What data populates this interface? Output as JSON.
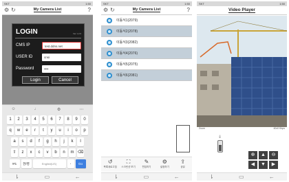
{
  "login_screen": {
    "status_time": "1:50",
    "status_left": "SKT",
    "header_title": "My Camera List",
    "dialog_title": "LOGIN",
    "version": "Ver 1.2.6",
    "cms_ip_label": "CMS IP",
    "cms_ip_value": "test.ddns.net",
    "user_id_label": "USER ID",
    "user_id_value": "cnsi",
    "password_label": "Password",
    "password_value": "••••",
    "login_button": "Login",
    "cancel_button": "Cancel",
    "keyboard_rows": [
      [
        "1",
        "2",
        "3",
        "4",
        "5",
        "6",
        "7",
        "8",
        "9",
        "0"
      ],
      [
        "q",
        "w",
        "e",
        "r",
        "t",
        "y",
        "u",
        "i",
        "o",
        "p"
      ],
      [
        "a",
        "s",
        "d",
        "f",
        "g",
        "h",
        "j",
        "k",
        "l"
      ],
      [
        "⇧",
        "z",
        "x",
        "c",
        "v",
        "b",
        "n",
        "m",
        "⌫"
      ]
    ],
    "kbd_symbols": "!#1",
    "kbd_lang": "한/영",
    "kbd_space": "English(US)",
    "kbd_go": "Go"
  },
  "list_screen": {
    "status_time": "1:50",
    "status_left": "SKT",
    "header_title": "My Camera List",
    "cameras": [
      "이동식1(2079)",
      "이동식2(2078)",
      "이동식3(2082)",
      "이동식4(2076)",
      "이동식5(2075)",
      "이동식6(2081)"
    ],
    "toolbar": [
      {
        "icon": "refresh-icon",
        "label": "목록새로고침"
      },
      {
        "icon": "fullscreen-icon",
        "label": "스크린샷 보기"
      },
      {
        "icon": "edit-icon",
        "label": "편집하기"
      },
      {
        "icon": "settings-icon",
        "label": "설정하기"
      },
      {
        "icon": "share-icon",
        "label": "공유"
      }
    ]
  },
  "player_screen": {
    "status_time": "1:50",
    "status_left": "SKT",
    "header_title": "Video Player",
    "video_left_stat": "Zoom",
    "video_right_stat": "40x0 Kbps"
  }
}
